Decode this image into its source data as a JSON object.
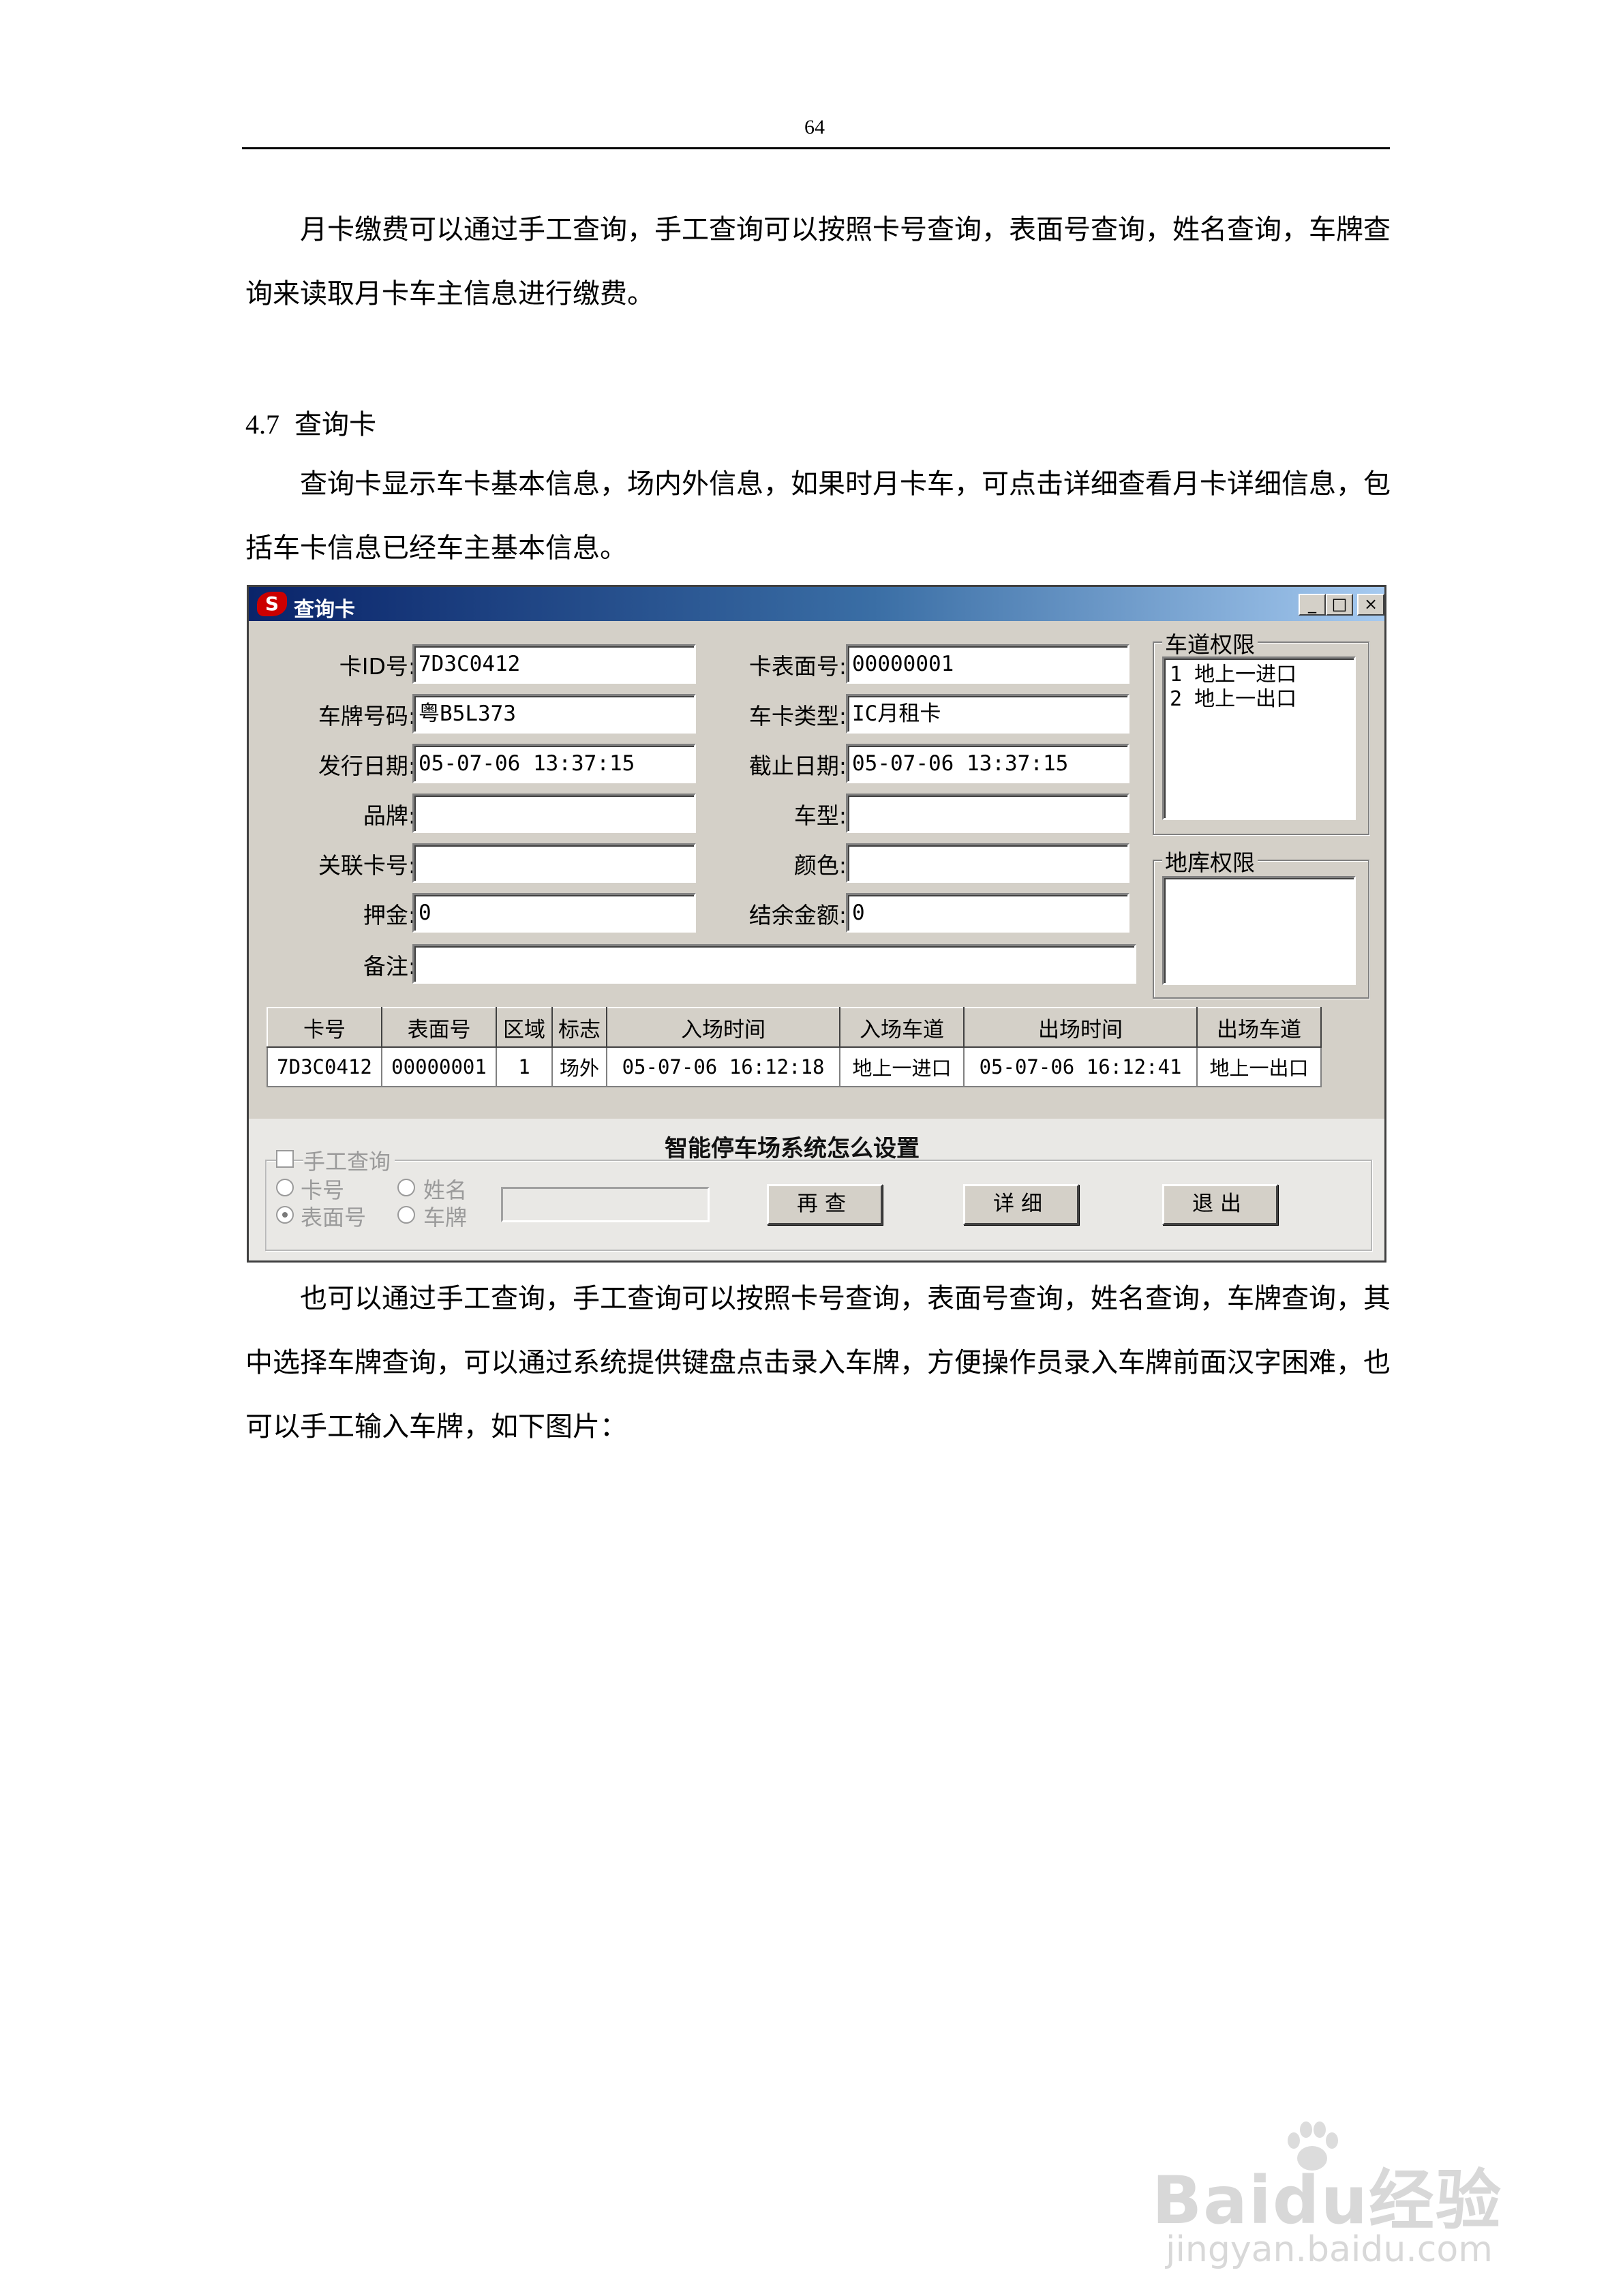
{
  "page": {
    "page_number": "64",
    "para1": "月卡缴费可以通过手工查询，手工查询可以按照卡号查询，表面号查询，姓名查询，车牌查询来读取月卡车主信息进行缴费。",
    "heading_number": "4.7",
    "heading_title": "查询卡",
    "para2": "查询卡显示车卡基本信息，场内外信息，如果时月卡车，可点击详细查看月卡详细信息，包括车卡信息已经车主基本信息。",
    "para3": "也可以通过手工查询，手工查询可以按照卡号查询，表面号查询，姓名查询，车牌查询，其中选择车牌查询，可以通过系统提供键盘点击录入车牌，方便操作员录入车牌前面汉字困难，也可以手工输入车牌，如下图片："
  },
  "window": {
    "title": "查询卡",
    "logo_glyph": "S",
    "btn_min": "_",
    "btn_max": "□",
    "btn_close": "×",
    "fields": {
      "card_id": {
        "label": "卡ID号:",
        "value": "7D3C0412"
      },
      "card_surface": {
        "label": "卡表面号:",
        "value": "00000001"
      },
      "plate": {
        "label": "车牌号码:",
        "value": "粤B5L373"
      },
      "card_type": {
        "label": "车卡类型:",
        "value": "IC月租卡"
      },
      "issue_date": {
        "label": "发行日期:",
        "value": "05-07-06 13:37:15"
      },
      "expire_date": {
        "label": "截止日期:",
        "value": "05-07-06 13:37:15"
      },
      "brand": {
        "label": "品牌:",
        "value": ""
      },
      "model": {
        "label": "车型:",
        "value": ""
      },
      "linked_card": {
        "label": "关联卡号:",
        "value": ""
      },
      "color": {
        "label": "颜色:",
        "value": ""
      },
      "deposit": {
        "label": "押金:",
        "value": "0"
      },
      "balance": {
        "label": "结余金额:",
        "value": "0"
      },
      "remark": {
        "label": "备注:",
        "value": ""
      }
    },
    "lane_rights": {
      "title": "车道权限",
      "items": [
        "1 地上一进口",
        "2 地上一出口"
      ]
    },
    "garage_rights": {
      "title": "地库权限",
      "items": []
    },
    "table": {
      "columns": [
        "卡号",
        "表面号",
        "区域",
        "标志",
        "入场时间",
        "入场车道",
        "出场时间",
        "出场车道"
      ],
      "rows": [
        [
          "7D3C0412",
          "00000001",
          "1",
          "场外",
          "05-07-06 16:12:18",
          "地上一进口",
          "05-07-06 16:12:41",
          "地上一出口"
        ]
      ]
    },
    "manual_query": {
      "label": "手工查询",
      "opt_card": "卡号",
      "opt_name": "姓名",
      "opt_surface": "表面号",
      "opt_plate": "车牌"
    },
    "banner": "智能停车场系统怎么设置",
    "buttons": {
      "requery": "再查",
      "detail": "详细",
      "exit": "退出"
    }
  },
  "watermark": {
    "brand": "Bai",
    "brand2": "du",
    "brand_cn": "经验",
    "url": "jingyan.baidu.com"
  }
}
